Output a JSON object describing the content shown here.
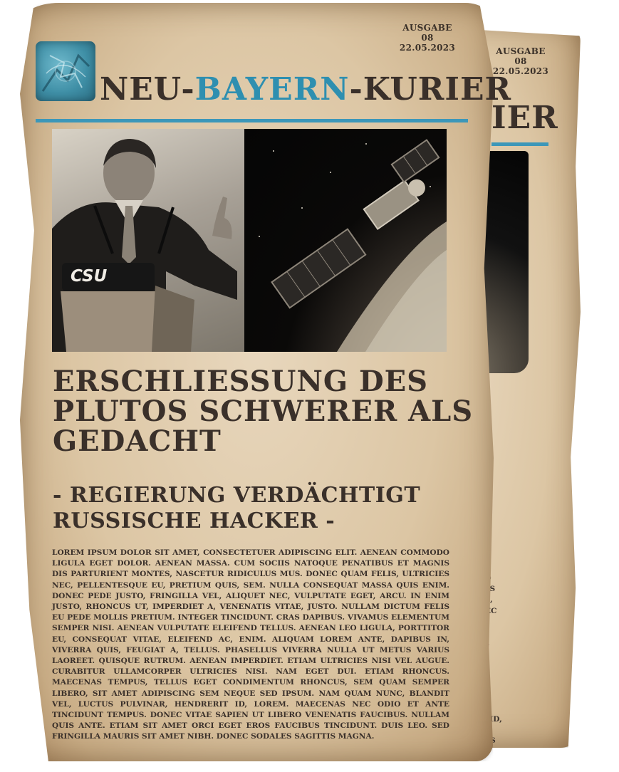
{
  "issue": {
    "label": "AUSGABE 08",
    "date": "22.05.2023"
  },
  "masthead": {
    "prefix": "NEU-",
    "highlight": "BAYERN",
    "suffix": "-KURIER",
    "back_fragment": "IER"
  },
  "photo": {
    "podium_text": "CSU"
  },
  "article": {
    "headline": "Erschliessung des Plutos schwerer als gedacht",
    "subheadline": "- Regierung verdächtigt Russische Hacker -",
    "body": "Lorem ipsum dolor sit amet, consectetuer adipiscing elit. Aenean commodo ligula eget dolor. Aenean massa. Cum sociis natoque penatibus et magnis dis parturient montes, nascetur ridiculus mus. Donec quam felis, ultricies nec, pellentesque eu, pretium quis, sem. Nulla consequat massa quis enim. Donec pede justo, fringilla vel, aliquet nec, vulputate eget, arcu. In enim justo, rhoncus ut, imperdiet a, venenatis vitae, justo. Nullam dictum felis eu pede mollis pretium. Integer tincidunt. Cras dapibus. Vivamus elementum semper nisi. Aenean vulputate eleifend tellus. Aenean leo ligula, porttitor eu, consequat vitae, eleifend ac, enim. Aliquam lorem ante, dapibus in, viverra quis, feugiat a, tellus. Phasellus viverra nulla ut metus varius laoreet. Quisque rutrum. Aenean imperdiet. Etiam ultricies nisi vel augue. Curabitur ullamcorper ultricies nisi. Nam eget dui. Etiam rhoncus. Maecenas tempus, tellus eget condimentum rhoncus, sem quam semper libero, sit amet adipiscing sem neque sed ipsum. Nam quam nunc, blandit vel, luctus pulvinar, hendrerit id, lorem. Maecenas nec odio et ante tincidunt tempus. Donec vitae sapien ut libero venenatis faucibus. Nullam quis ante. Etiam sit amet orci eget eros faucibus tincidunt. Duis leo. Sed fringilla mauris sit amet nibh. Donec sodales sagittis magna.",
    "back_fragment": "odo\ns dis\nnec,\nonec\n\nde\nper\non-\nuis,\nsie\nm-\nlis\nsem\nrit id,\nut\neros\nsoda-"
  },
  "colors": {
    "accent": "#3c97b9",
    "ink": "#3a302a",
    "paper": "#dcc6a4"
  }
}
